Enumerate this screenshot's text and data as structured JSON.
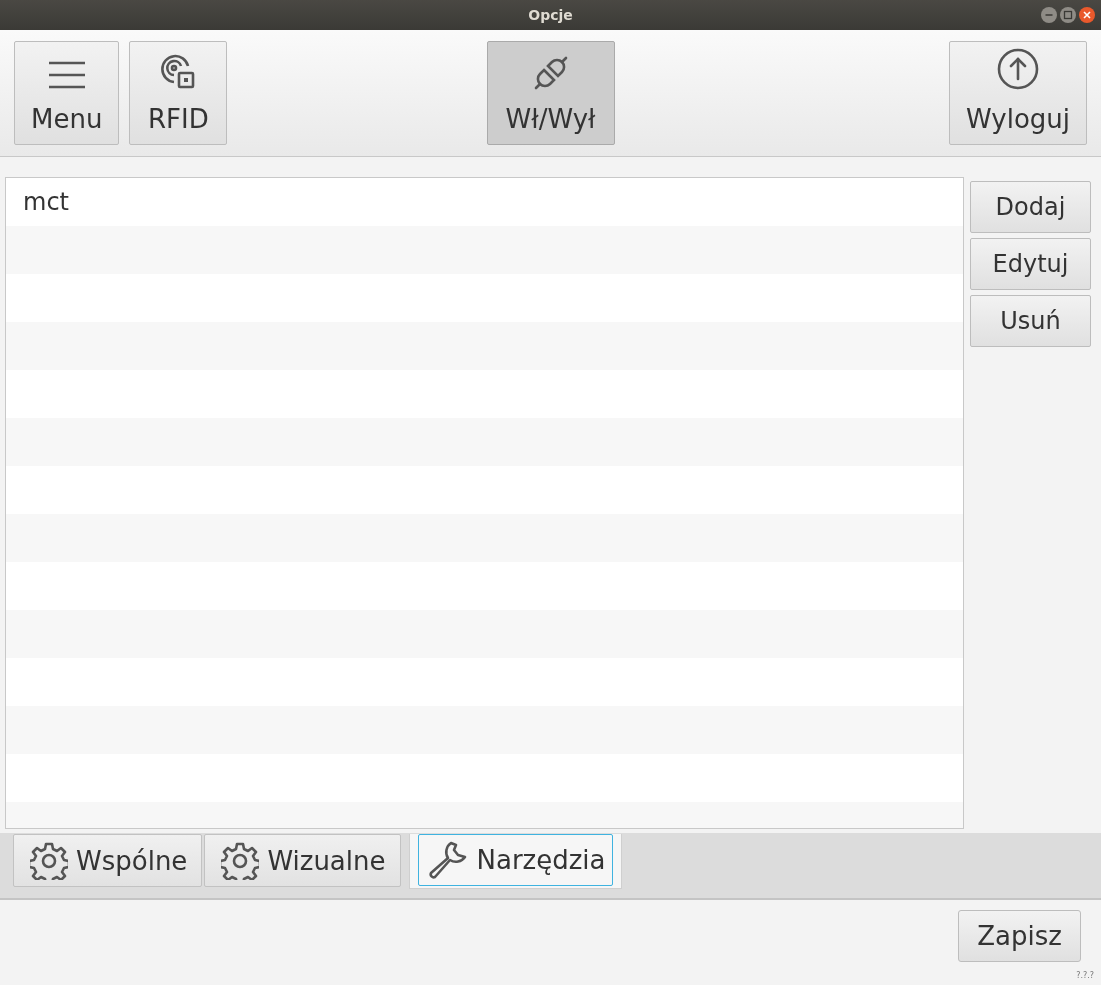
{
  "window": {
    "title": "Opcje"
  },
  "toolbar": {
    "left": [
      {
        "label": "Menu",
        "kind": "menu",
        "pressed": false
      },
      {
        "label": "RFID",
        "kind": "rfid",
        "pressed": false
      }
    ],
    "center": [
      {
        "label": "Wł/Wył",
        "kind": "plug",
        "pressed": true
      }
    ],
    "right": [
      {
        "label": "Wyloguj",
        "kind": "logout",
        "pressed": false
      }
    ]
  },
  "list": {
    "items": [
      "mct"
    ]
  },
  "side_buttons": [
    "Dodaj",
    "Edytuj",
    "Usuń"
  ],
  "tabs": [
    {
      "label": "Wspólne",
      "kind": "gear",
      "selected": false
    },
    {
      "label": "Wizualne",
      "kind": "gear",
      "selected": false
    },
    {
      "label": "Narzędzia",
      "kind": "wrench",
      "selected": true
    }
  ],
  "save_button": "Zapisz",
  "version": "?.?.?"
}
